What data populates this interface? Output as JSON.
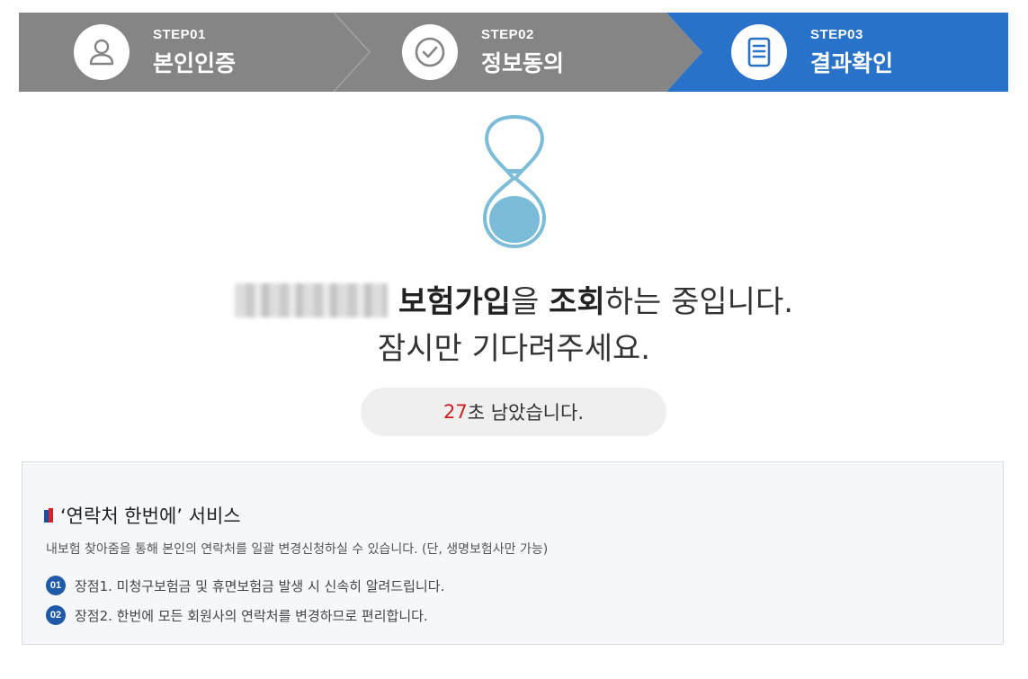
{
  "steps": [
    {
      "no": "STEP01",
      "title": "본인인증",
      "icon": "user-icon",
      "state": "done"
    },
    {
      "no": "STEP02",
      "title": "정보동의",
      "icon": "check-circle-icon",
      "state": "done"
    },
    {
      "no": "STEP03",
      "title": "결과확인",
      "icon": "document-icon",
      "state": "active"
    }
  ],
  "colors": {
    "step_inactive": "#858585",
    "step_active": "#2872c9",
    "hourglass": "#7bbcd8",
    "countdown_number": "#cc1f1f",
    "badge": "#1f5aa8"
  },
  "message": {
    "blurred_name": "redacted-name",
    "bold1": "보험가입",
    "text1": "을 ",
    "bold2": "조회",
    "text2": "하는 중입니다.",
    "line2": "잠시만 기다려주세요."
  },
  "countdown": {
    "seconds": "27",
    "suffix": "초 남았습니다."
  },
  "info": {
    "title": "‘연락처 한번에’ 서비스",
    "description": "내보험 찾아줌을 통해 본인의 연락처를 일괄 변경신청하실 수 있습니다. (단, 생명보험사만 가능)",
    "benefits": [
      {
        "badge": "01",
        "text": "장점1. 미청구보험금 및 휴면보험금 발생 시 신속히 알려드립니다."
      },
      {
        "badge": "02",
        "text": "장점2. 한번에 모든 회원사의 연락처를 변경하므로 편리합니다."
      }
    ]
  }
}
